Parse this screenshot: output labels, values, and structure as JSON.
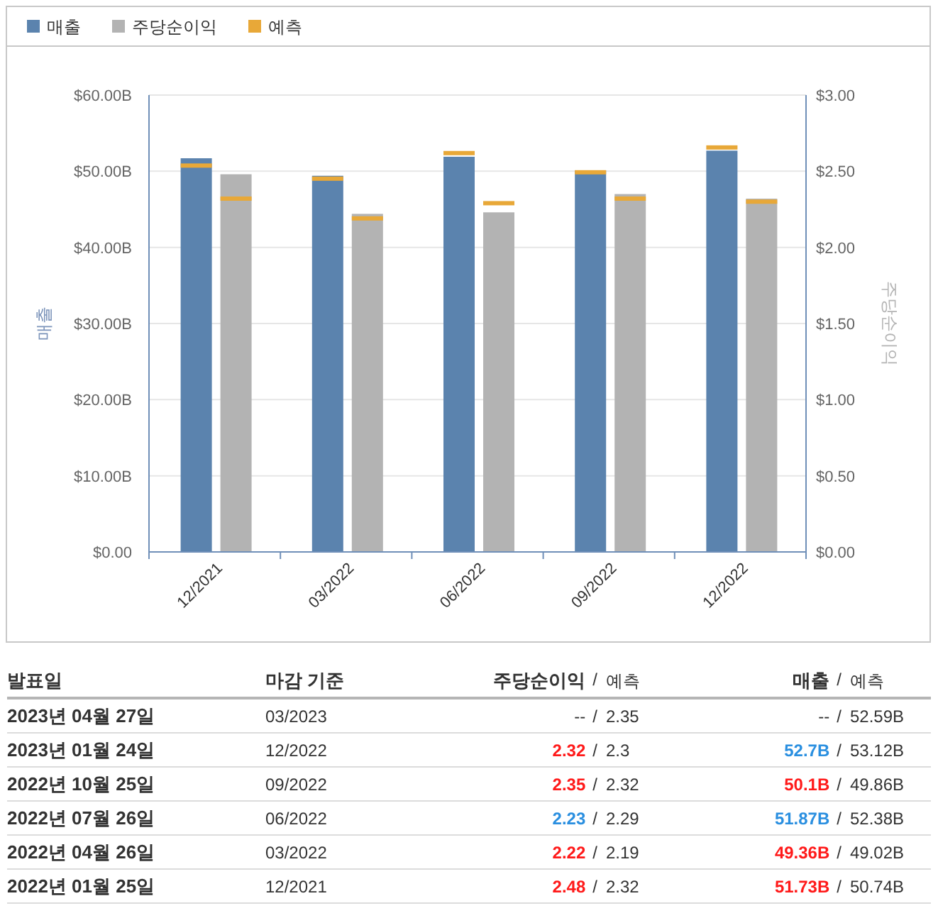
{
  "chart": {
    "forecast_legend": {
      "label": "예측",
      "color": "#e8a838"
    },
    "chart_data": {
      "type": "bar",
      "categories": [
        "12/2021",
        "03/2022",
        "06/2022",
        "09/2022",
        "12/2022"
      ],
      "ylabel": "매출",
      "y2label": "주당순이익",
      "ylim": [
        0,
        60
      ],
      "y2lim": [
        0,
        3
      ],
      "yticks": [
        {
          "value": 0,
          "label": "$0.00"
        },
        {
          "value": 10,
          "label": "$10.00B"
        },
        {
          "value": 20,
          "label": "$20.00B"
        },
        {
          "value": 30,
          "label": "$30.00B"
        },
        {
          "value": 40,
          "label": "$40.00B"
        },
        {
          "value": 50,
          "label": "$50.00B"
        },
        {
          "value": 60,
          "label": "$60.00B"
        }
      ],
      "y2ticks": [
        {
          "value": 0,
          "label": "$0.00"
        },
        {
          "value": 0.5,
          "label": "$0.50"
        },
        {
          "value": 1,
          "label": "$1.00"
        },
        {
          "value": 1.5,
          "label": "$1.50"
        },
        {
          "value": 2,
          "label": "$2.00"
        },
        {
          "value": 2.5,
          "label": "$2.50"
        },
        {
          "value": 3,
          "label": "$3.00"
        }
      ],
      "series": [
        {
          "name": "매출",
          "color": "#5b83ae",
          "values": [
            51.7,
            49.4,
            51.9,
            50.1,
            52.7
          ]
        },
        {
          "name": "주당순이익",
          "color": "#b3b3b3",
          "axis": "y2",
          "values": [
            2.48,
            2.22,
            2.23,
            2.35,
            2.32
          ]
        }
      ],
      "grid": true
    }
  },
  "table": {
    "columns": [
      {
        "label": "발표일"
      },
      {
        "label": "마감 기준"
      },
      {
        "label": "주당순이익",
        "separator": "/"
      },
      {
        "label": "예측"
      },
      {
        "label": "매출",
        "separator": "/"
      },
      {
        "label": "예측"
      }
    ],
    "rows": [
      {
        "date": "2023년 04월 27일",
        "period": "03/2023",
        "eps": {
          "value": "--",
          "separator": "/"
        },
        "eps_forecast": "2.35",
        "revenue": {
          "value": "--",
          "separator": "/"
        },
        "revenue_forecast": "52.59B"
      },
      {
        "date": "2023년 01월 24일",
        "period": "12/2022",
        "eps": {
          "value": "2.32",
          "color": "#ff1a1a",
          "separator": "/"
        },
        "eps_forecast": "2.3",
        "revenue": {
          "value": "52.7B",
          "color": "#2a8fe0",
          "separator": "/"
        },
        "revenue_forecast": "53.12B"
      },
      {
        "date": "2022년 10월 25일",
        "period": "09/2022",
        "eps": {
          "value": "2.35",
          "color": "#ff1a1a",
          "separator": "/"
        },
        "eps_forecast": "2.32",
        "revenue": {
          "value": "50.1B",
          "color": "#ff1a1a",
          "separator": "/"
        },
        "revenue_forecast": "49.86B"
      },
      {
        "date": "2022년 07월 26일",
        "period": "06/2022",
        "eps": {
          "value": "2.23",
          "color": "#2a8fe0",
          "separator": "/"
        },
        "eps_forecast": "2.29",
        "revenue": {
          "value": "51.87B",
          "color": "#2a8fe0",
          "separator": "/"
        },
        "revenue_forecast": "52.38B"
      },
      {
        "date": "2022년 04월 26일",
        "period": "03/2022",
        "eps": {
          "value": "2.22",
          "color": "#ff1a1a",
          "separator": "/"
        },
        "eps_forecast": "2.19",
        "revenue": {
          "value": "49.36B",
          "color": "#ff1a1a",
          "separator": "/"
        },
        "revenue_forecast": "49.02B"
      },
      {
        "date": "2022년 01월 25일",
        "period": "12/2021",
        "eps": {
          "value": "2.48",
          "color": "#ff1a1a",
          "separator": "/"
        },
        "eps_forecast": "2.32",
        "revenue": {
          "value": "51.73B",
          "color": "#ff1a1a",
          "separator": "/"
        },
        "revenue_forecast": "50.74B"
      }
    ]
  }
}
